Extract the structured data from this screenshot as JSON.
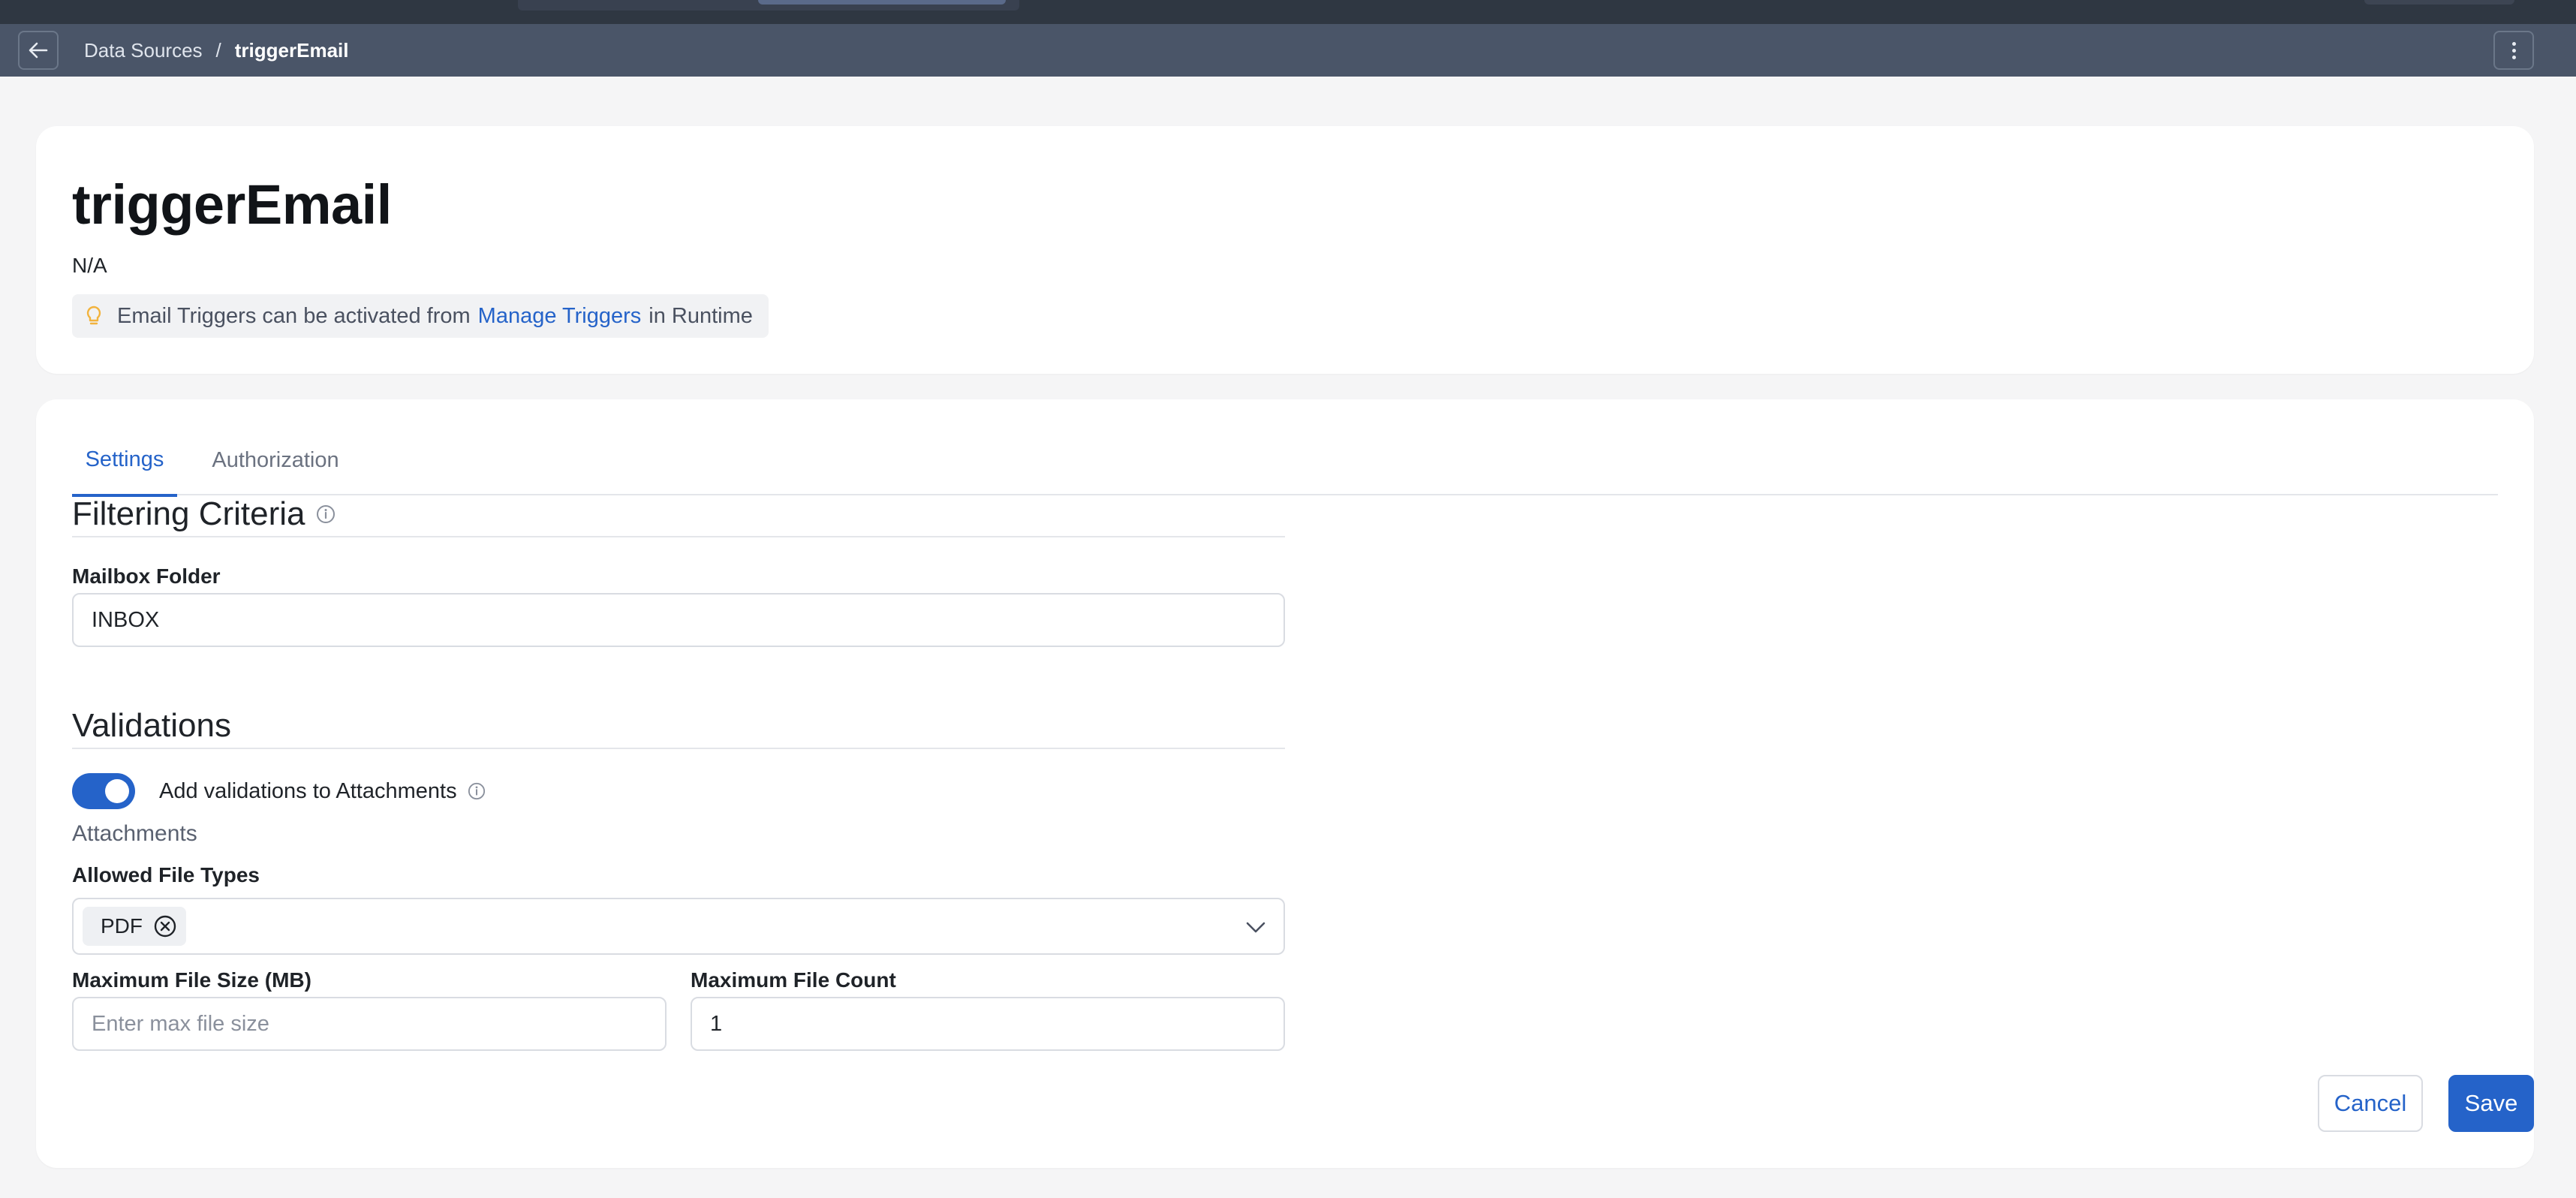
{
  "nav": {
    "breadcrumb_parent": "Data Sources",
    "breadcrumb_separator": "/",
    "breadcrumb_current": "triggerEmail"
  },
  "header": {
    "title": "triggerEmail",
    "subtitle": "N/A",
    "hint_prefix": "Email Triggers can be activated from",
    "hint_link": "Manage Triggers",
    "hint_suffix": "in Runtime"
  },
  "tabs": [
    {
      "label": "Settings",
      "active": true
    },
    {
      "label": "Authorization",
      "active": false
    }
  ],
  "filtering": {
    "section_title": "Filtering Criteria",
    "mailbox_label": "Mailbox Folder",
    "mailbox_value": "INBOX"
  },
  "validations": {
    "section_title": "Validations",
    "toggle_label": "Add validations to Attachments",
    "toggle_on": true,
    "attachments_heading": "Attachments",
    "file_types_label": "Allowed File Types",
    "file_types_selected": [
      "PDF"
    ],
    "max_size_label": "Maximum File Size (MB)",
    "max_size_value": "",
    "max_size_placeholder": "Enter max file size",
    "max_count_label": "Maximum File Count",
    "max_count_value": "1"
  },
  "actions": {
    "cancel_label": "Cancel",
    "save_label": "Save"
  },
  "colors": {
    "accent": "#2563c9",
    "navbar": "#4a5568",
    "hint_icon": "#f2b33d"
  }
}
